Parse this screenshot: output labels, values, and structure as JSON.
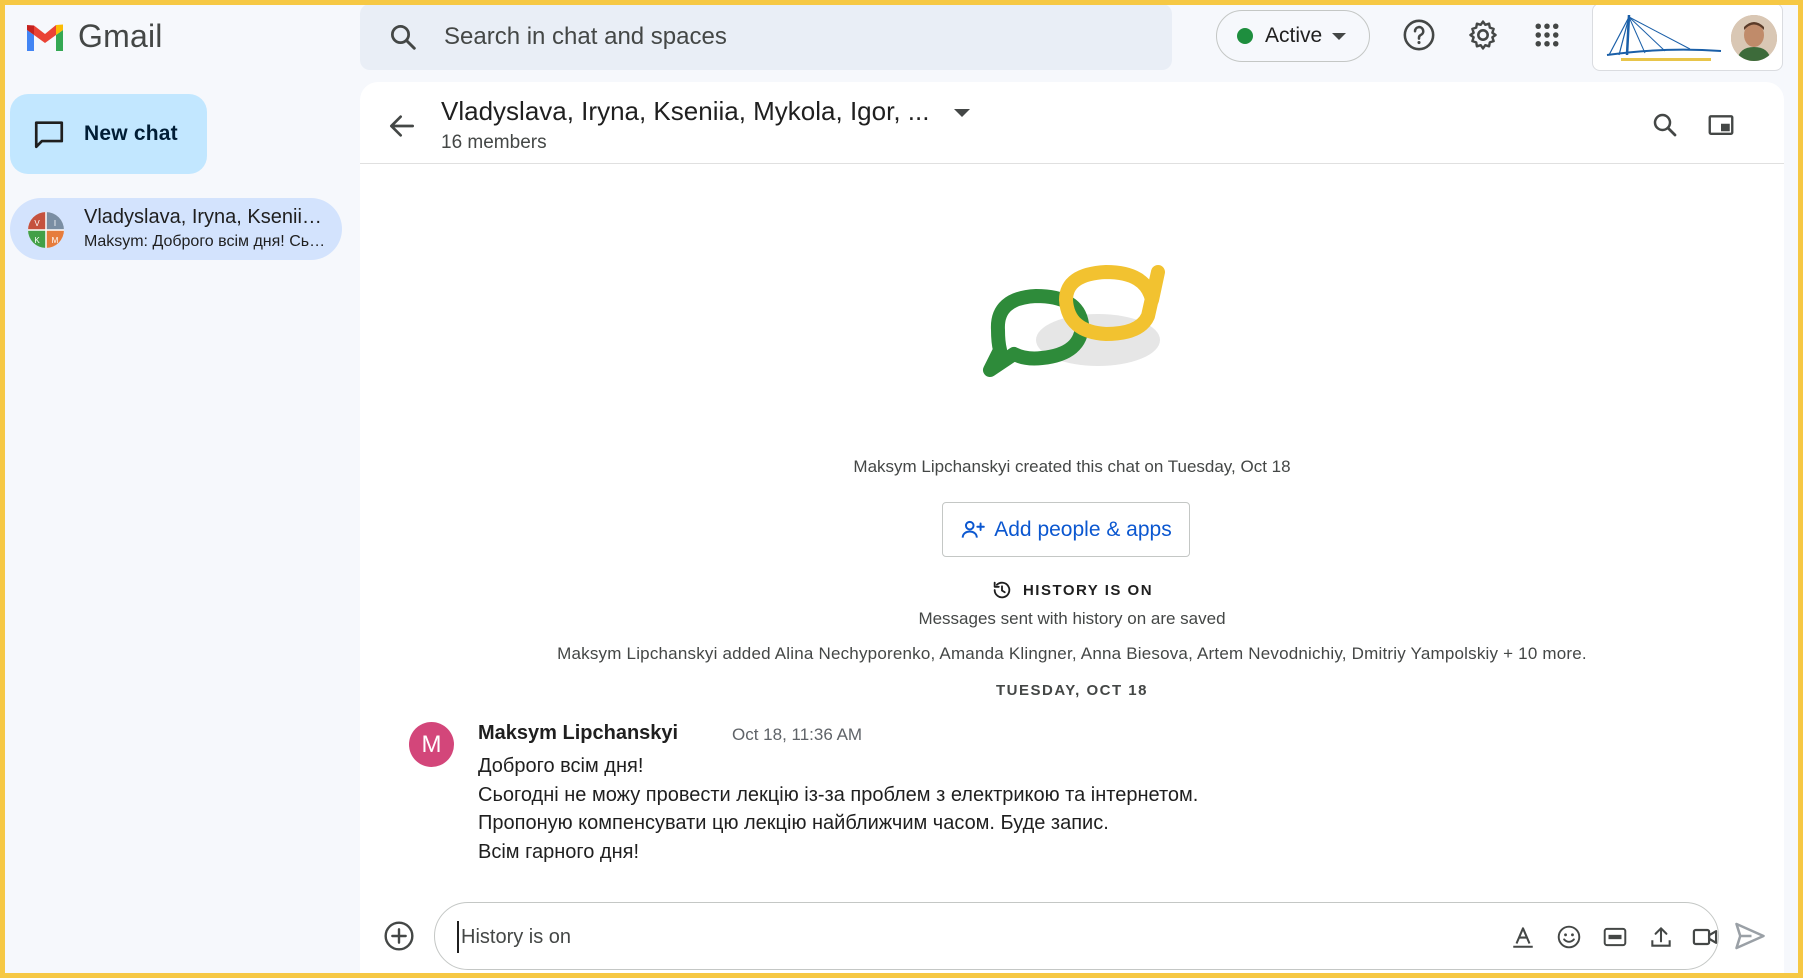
{
  "app": {
    "name": "Gmail"
  },
  "search": {
    "placeholder": "Search in chat and spaces"
  },
  "status": {
    "label": "Active",
    "color": "#1e8e3e"
  },
  "topbar_icons": [
    "help-icon",
    "settings-gear-icon",
    "apps-grid-icon"
  ],
  "sidebar": {
    "new_chat_label": "New chat",
    "conversations": [
      {
        "title": "Vladyslava, Iryna, Kseniia, Mykola, Igor, ...",
        "snippet": "Maksym: Доброго всім дня! Сьогодні не можу провести лекцію",
        "avatar_letters": [
          "V",
          "I",
          "K",
          "M"
        ]
      }
    ]
  },
  "chat": {
    "title": "Vladyslava, Iryna, Kseniia, Mykola, Igor, ...",
    "members": "16 members",
    "created_text": "Maksym Lipchanskyi created this chat on Tuesday, Oct 18",
    "add_button_label": "Add people & apps",
    "history_title": "HISTORY IS ON",
    "history_subtitle": "Messages sent with history on are saved",
    "added_text": "Maksym Lipchanskyi added Alina Nechyporenko, Amanda Klingner, Anna Biesova, Artem Nevodnichiy, Dmitriy Yampolskiy + 10 more.",
    "date_divider": "TUESDAY, OCT 18"
  },
  "messages": [
    {
      "avatar_initial": "M",
      "sender": "Maksym Lipchanskyi",
      "time": "Oct 18, 11:36 AM",
      "lines": [
        "Доброго всім дня!",
        "Сьогодні не можу провести лекцію із-за проблем з електрикою та інтернетом.",
        "Пропоную компенсувати цю лекцію найближчим часом. Буде запис.",
        "Всім гарного дня!"
      ]
    }
  ],
  "composer": {
    "placeholder": "History is on",
    "icons": [
      "text-format-icon",
      "emoji-icon",
      "gif-icon",
      "upload-icon",
      "video-meeting-icon"
    ]
  },
  "colors": {
    "accent_blue": "#0b57d0",
    "new_chat_bg": "#c2e7ff",
    "selected_conv_bg": "#d3e3fd",
    "avatar_pink": "#d3467a",
    "frame_yellow": "#f6c844"
  }
}
